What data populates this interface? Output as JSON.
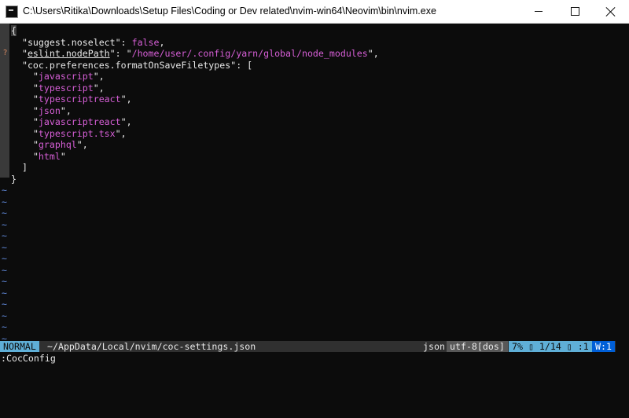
{
  "window": {
    "title": "C:\\Users\\Ritika\\Downloads\\Setup Files\\Coding or Dev related\\nvim-win64\\Neovim\\bin\\nvim.exe",
    "app_icon": "terminal-icon"
  },
  "editor": {
    "lines": [
      {
        "sign": "",
        "code": "{"
      },
      {
        "sign": "",
        "code": "  \"suggest.noselect\": false,"
      },
      {
        "sign": "?",
        "code": "  \"eslint.nodePath\": \"/home/user/.config/yarn/global/node_modules\","
      },
      {
        "sign": "",
        "code": "  \"coc.preferences.formatOnSaveFiletypes\": ["
      },
      {
        "sign": "",
        "code": "    \"javascript\","
      },
      {
        "sign": "",
        "code": "    \"typescript\","
      },
      {
        "sign": "",
        "code": "    \"typescriptreact\","
      },
      {
        "sign": "",
        "code": "    \"json\","
      },
      {
        "sign": "",
        "code": "    \"javascriptreact\","
      },
      {
        "sign": "",
        "code": "    \"typescript.tsx\","
      },
      {
        "sign": "",
        "code": "    \"graphql\","
      },
      {
        "sign": "",
        "code": "    \"html\""
      },
      {
        "sign": "",
        "code": "  ]"
      },
      {
        "sign": "",
        "code": "}"
      }
    ],
    "tilde": "~",
    "tilde_count": 14
  },
  "statusline": {
    "mode": "NORMAL",
    "filepath": "~/AppData/Local/nvim/coc-settings.json",
    "filetype": "json",
    "encoding": "utf-8[dos]",
    "position": "7% ▯ 1/14 ▯ :1",
    "warnings": "W:1"
  },
  "cmdline": ":CocConfig"
}
